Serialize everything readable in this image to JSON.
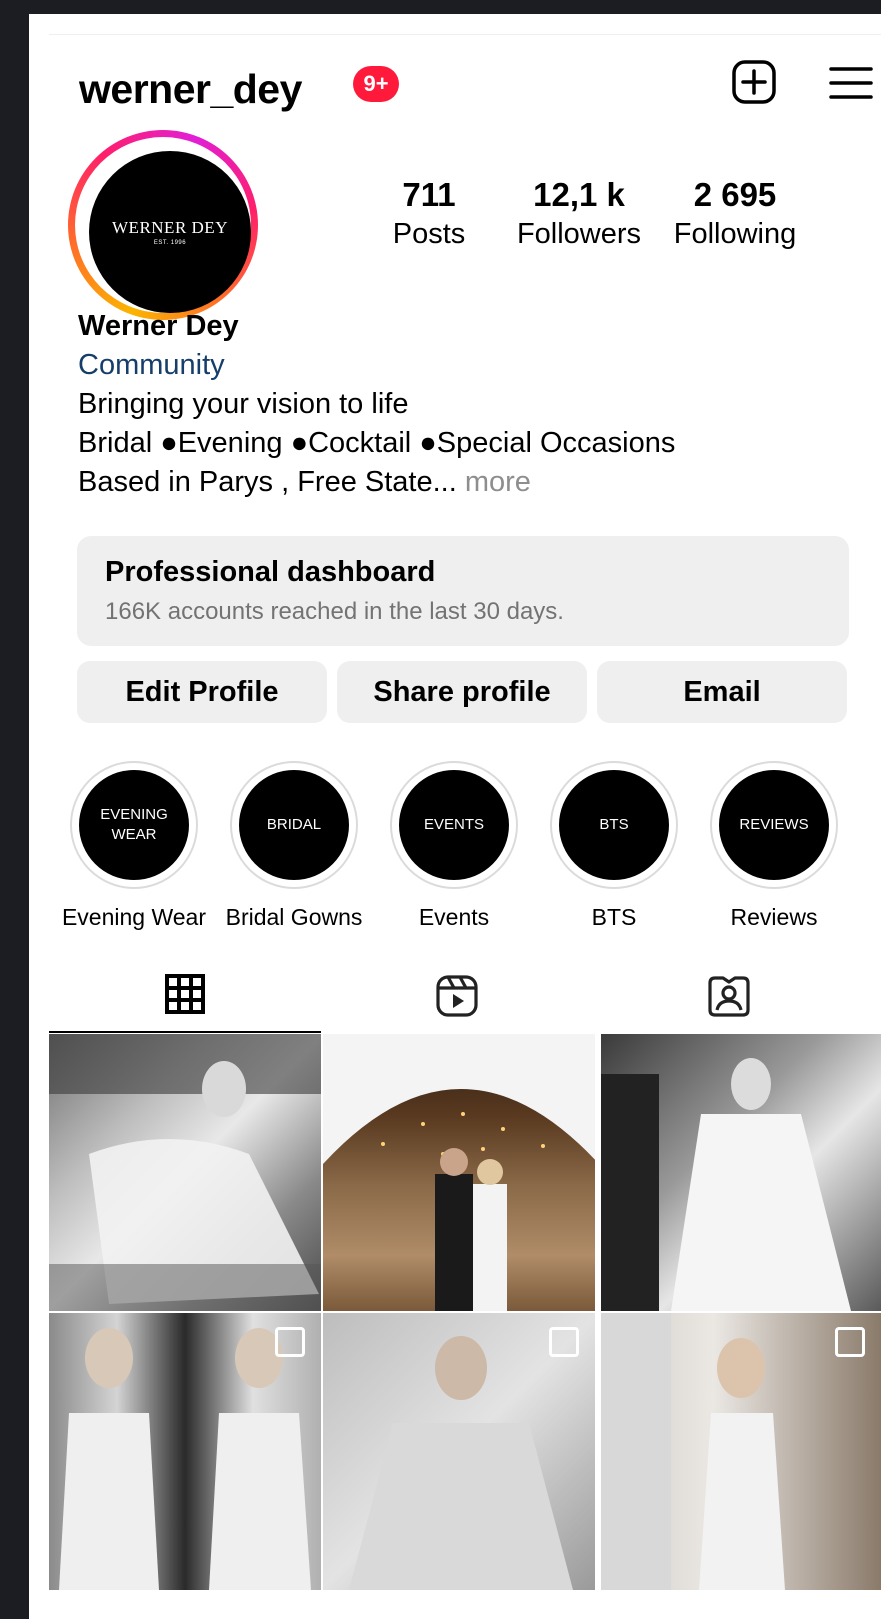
{
  "header": {
    "username": "werner_dey",
    "notification_badge": "9+"
  },
  "profile": {
    "avatar": {
      "brand": "WERNER DEY",
      "est": "EST. 1996"
    },
    "stats": [
      {
        "value": "711",
        "label": "Posts"
      },
      {
        "value": "12,1 k",
        "label": "Followers"
      },
      {
        "value": "2 695",
        "label": "Following"
      }
    ],
    "name": "Werner Dey",
    "category": "Community",
    "bio_line1": "Bringing your vision to life",
    "bio_line2": "Bridal ●Evening ●Cocktail ●Special Occasions",
    "bio_line3": "Based in Parys , Free State...",
    "more": " more"
  },
  "dashboard": {
    "title": "Professional dashboard",
    "subtitle": "166K accounts reached in the last 30 days."
  },
  "buttons": {
    "edit": "Edit Profile",
    "share": "Share profile",
    "email": "Email"
  },
  "highlights": [
    {
      "cover_text": "EVENING\nWEAR",
      "caption": "Evening Wear"
    },
    {
      "cover_text": "BRIDAL",
      "caption": "Bridal Gowns"
    },
    {
      "cover_text": "EVENTS",
      "caption": "Events"
    },
    {
      "cover_text": "BTS",
      "caption": "BTS"
    },
    {
      "cover_text": "REVIEWS",
      "caption": "Reviews"
    }
  ],
  "tabs": {
    "active": "grid",
    "icons": [
      "grid-icon",
      "reels-icon",
      "tagged-icon"
    ]
  },
  "colors": {
    "badge": "#ff1a3c",
    "category_link": "#163e6b",
    "button_bg": "#efefef"
  }
}
